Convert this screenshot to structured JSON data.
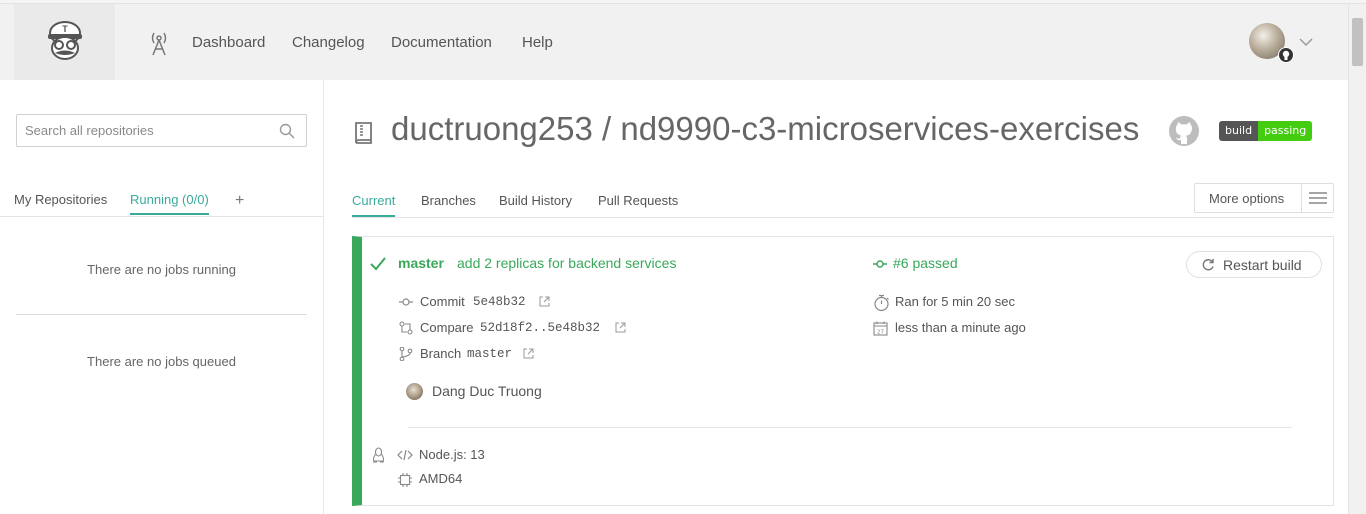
{
  "nav": {
    "links": [
      "Dashboard",
      "Changelog",
      "Documentation",
      "Help"
    ]
  },
  "sidebar": {
    "search_placeholder": "Search all repositories",
    "tabs": [
      "My Repositories",
      "Running (0/0)"
    ],
    "add_label": "+",
    "no_running": "There are no jobs running",
    "no_queued": "There are no jobs queued"
  },
  "repo": {
    "title": "ductruong253 / nd9990-c3-microservices-exercises",
    "badge_left": "build",
    "badge_right": "passing"
  },
  "tabs": [
    "Current",
    "Branches",
    "Build History",
    "Pull Requests"
  ],
  "more_options": "More options",
  "build": {
    "branch": "master",
    "message": "add 2 replicas for backend services",
    "status": "#6 passed",
    "restart_label": "Restart build",
    "commit_label": "Commit",
    "commit_hash": "5e48b32",
    "compare_label": "Compare",
    "compare_range": "52d18f2..5e48b32",
    "branch_label": "Branch",
    "branch_name": "master",
    "duration": "Ran for 5 min 20 sec",
    "finished": "less than a minute ago",
    "author": "Dang Duc Truong",
    "language": "Node.js: 13",
    "arch": "AMD64"
  },
  "colors": {
    "accent": "#39aa9c",
    "passed_green": "#39a85b",
    "badge_green": "#44cc11",
    "badge_gray": "#555555"
  }
}
